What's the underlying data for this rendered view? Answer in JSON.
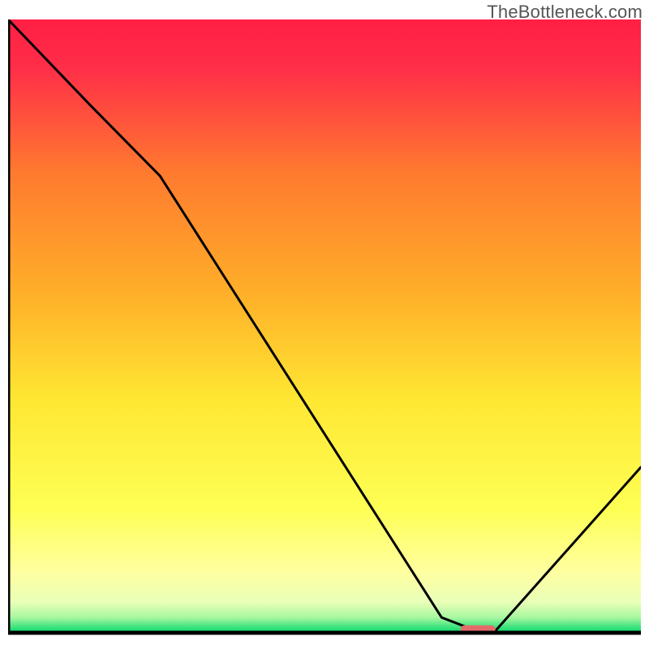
{
  "watermark": "TheBottleneck.com",
  "chart_data": {
    "type": "line",
    "title": "",
    "xlabel": "",
    "ylabel": "",
    "xlim": [
      0,
      100
    ],
    "ylim": [
      0,
      100
    ],
    "grid": false,
    "legend": false,
    "note": "Axes are unlabeled in the source image; values are estimated as 0–100 percentages of the plot area.",
    "colors": {
      "gradient_top": "#ff1f44",
      "gradient_upper_mid": "#ffa324",
      "gradient_mid": "#ffe733",
      "gradient_lower": "#ffff9c",
      "gradient_bottom": "#00d86a",
      "line": "#000000",
      "marker": "#e46a6a",
      "axis": "#000000"
    },
    "series": [
      {
        "name": "bottleneck-curve",
        "x": [
          0.0,
          13.0,
          24.0,
          68.5,
          74.0,
          77.0,
          100.0
        ],
        "y": [
          100.0,
          86.0,
          74.5,
          2.5,
          0.3,
          0.3,
          27.0
        ]
      }
    ],
    "marker": {
      "name": "optimal-range",
      "x_start": 71.5,
      "x_end": 77.0,
      "y": 0.5
    }
  }
}
